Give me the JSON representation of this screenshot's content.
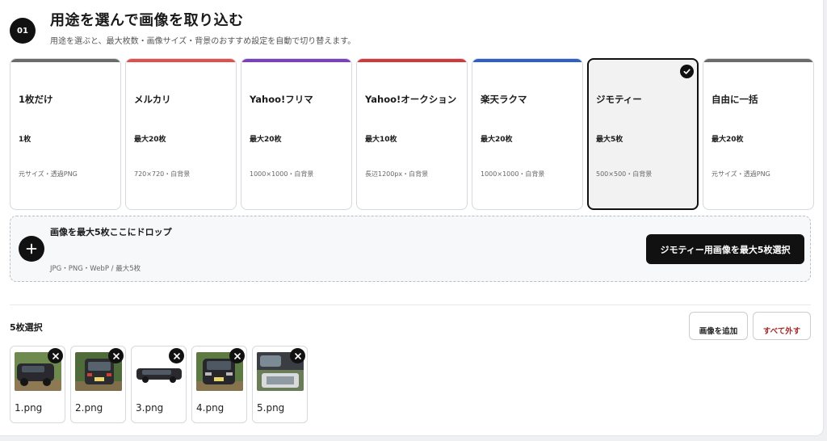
{
  "header": {
    "step": "01",
    "title": "用途を選んで画像を取り込む",
    "subtitle": "用途を選ぶと、最大枚数・画像サイズ・背景のおすすめ設定を自動で切り替えます。"
  },
  "presets": [
    {
      "name": "1枚だけ",
      "count": "1枚",
      "spec": "元サイズ・透過PNG",
      "color": "#6b6b6b",
      "selected": false
    },
    {
      "name": "メルカリ",
      "count": "最大20枚",
      "spec": "720×720・白背景",
      "color": "#e0504f",
      "selected": false
    },
    {
      "name": "Yahoo!フリマ",
      "count": "最大20枚",
      "spec": "1000×1000・白背景",
      "color": "#7b3fbf",
      "selected": false
    },
    {
      "name": "Yahoo!オークション",
      "count": "最大10枚",
      "spec": "長辺1200px・白背景",
      "color": "#d23a3a",
      "selected": false
    },
    {
      "name": "楽天ラクマ",
      "count": "最大20枚",
      "spec": "1000×1000・白背景",
      "color": "#2f5fc4",
      "selected": false
    },
    {
      "name": "ジモティー",
      "count": "最大5枚",
      "spec": "500×500・白背景",
      "color": "#111111",
      "selected": true
    },
    {
      "name": "自由に一括",
      "count": "最大20枚",
      "spec": "元サイズ・透過PNG",
      "color": "#6b6b6b",
      "selected": false
    }
  ],
  "dropzone": {
    "title": "画像を最大5枚ここにドロップ",
    "hint": "JPG・PNG・WebP / 最大5枚",
    "select_button": "ジモティー用画像を最大5枚選択"
  },
  "selection": {
    "count_label": "5枚選択",
    "add_button": "画像を追加",
    "clear_button": "すべて外す",
    "files": [
      {
        "name": "1.png"
      },
      {
        "name": "2.png"
      },
      {
        "name": "3.png"
      },
      {
        "name": "4.png"
      },
      {
        "name": "5.png"
      }
    ]
  },
  "icons": {
    "step_badge": "number-badge",
    "selected_check": "check-circle-icon",
    "add": "plus-circle-icon",
    "remove": "close-icon"
  }
}
